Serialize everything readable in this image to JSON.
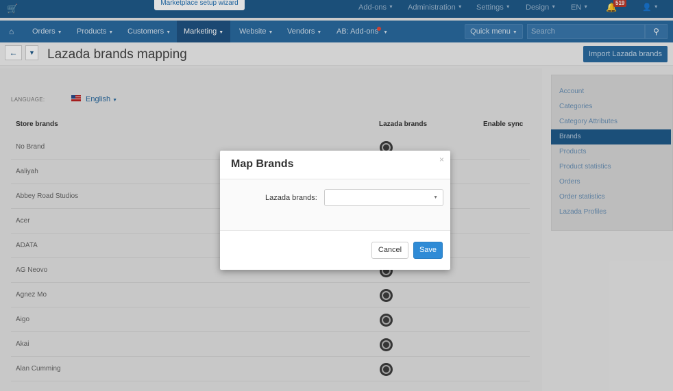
{
  "topbar": {
    "cart_icon": "cart-icon",
    "wizard_label": "Marketplace setup wizard",
    "menus": [
      {
        "label": "Add-ons"
      },
      {
        "label": "Administration"
      },
      {
        "label": "Settings"
      },
      {
        "label": "Design"
      },
      {
        "label": "EN"
      }
    ],
    "notifications_count": "519",
    "user_icon": "user-icon"
  },
  "mainnav": {
    "home_icon": "home-icon",
    "items": [
      {
        "label": "Orders"
      },
      {
        "label": "Products"
      },
      {
        "label": "Customers"
      },
      {
        "label": "Marketing"
      },
      {
        "label": "Website"
      },
      {
        "label": "Vendors"
      },
      {
        "label": "AB: Add-ons"
      }
    ],
    "active_item": "Marketing",
    "quick_menu_label": "Quick menu",
    "search_placeholder": "Search"
  },
  "page": {
    "title": "Lazada brands mapping",
    "import_button": "Import Lazada brands"
  },
  "content": {
    "language_label": "LANGUAGE:",
    "language_value": "English",
    "columns": {
      "store_brands": "Store brands",
      "lazada_brands": "Lazada brands",
      "enable_sync": "Enable sync"
    },
    "brands": [
      "No Brand",
      "Aaliyah",
      "Abbey Road Studios",
      "Acer",
      "ADATA",
      "AG Neovo",
      "Agnez Mo",
      "Aigo",
      "Akai",
      "Alan Cumming"
    ]
  },
  "sidebar": {
    "items": [
      {
        "label": "Account"
      },
      {
        "label": "Categories"
      },
      {
        "label": "Category Attributes"
      },
      {
        "label": "Brands"
      },
      {
        "label": "Products"
      },
      {
        "label": "Product statistics"
      },
      {
        "label": "Orders"
      },
      {
        "label": "Order statistics"
      },
      {
        "label": "Lazada Profiles"
      }
    ],
    "active_item": "Brands"
  },
  "modal": {
    "title": "Map Brands",
    "field_label": "Lazada brands:",
    "field_value": "",
    "cancel_label": "Cancel",
    "save_label": "Save"
  },
  "colors": {
    "topbar_bg": "#1f5a8a",
    "nav_bg": "#2a6aa0",
    "accent": "#2f8bd6",
    "badge": "#c0392b"
  }
}
